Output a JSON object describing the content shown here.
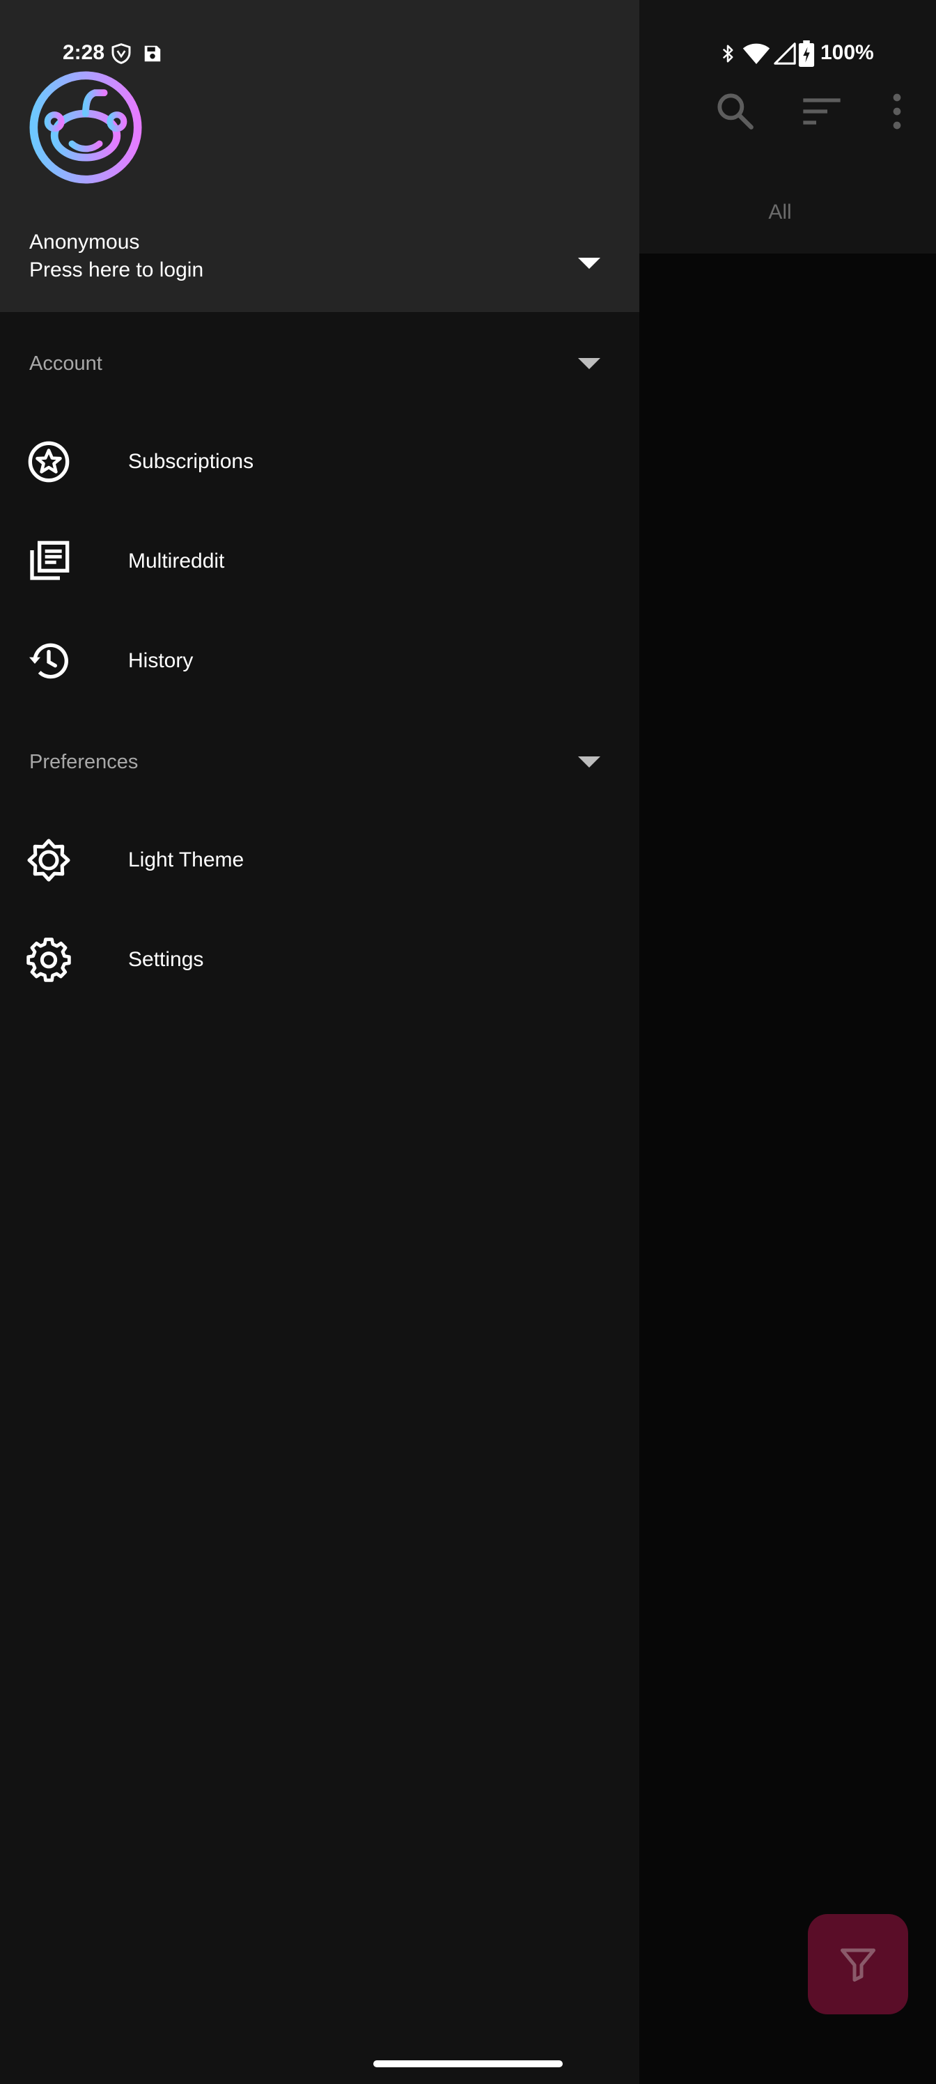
{
  "status_bar": {
    "time": "2:28",
    "battery": "100%",
    "icons": [
      "shield-icon",
      "save-icon",
      "bluetooth-icon",
      "wifi-icon",
      "signal-icon",
      "battery-charging-icon"
    ]
  },
  "app": {
    "toolbar_icons": [
      "search-icon",
      "sort-icon",
      "more-vert-icon"
    ],
    "tab_label": "All",
    "fab_icon": "filter-icon"
  },
  "drawer": {
    "header": {
      "account_name": "Anonymous",
      "subtitle": "Press here to login",
      "avatar_icon": "infinity-logo-icon"
    },
    "sections": [
      {
        "label": "Account",
        "items": [
          {
            "label": "Subscriptions",
            "icon": "star-circle-icon"
          },
          {
            "label": "Multireddit",
            "icon": "library-books-icon"
          },
          {
            "label": "History",
            "icon": "history-icon"
          }
        ]
      },
      {
        "label": "Preferences",
        "items": [
          {
            "label": "Light Theme",
            "icon": "brightness-icon"
          },
          {
            "label": "Settings",
            "icon": "settings-gear-icon"
          }
        ]
      }
    ]
  },
  "colors": {
    "drawer_bg": "#121212",
    "header_bg": "#252525",
    "fab_bg": "#5a0d28",
    "avatar_gradient_start": "#6ec8ff",
    "avatar_gradient_end": "#e57cff"
  }
}
